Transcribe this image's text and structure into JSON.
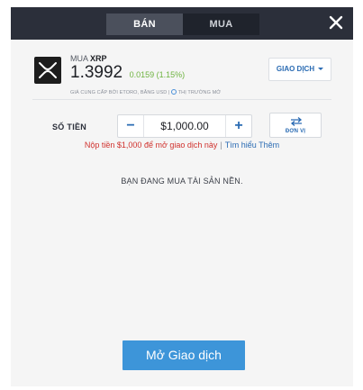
{
  "tabs": [
    {
      "label": "BÁN",
      "active": true
    },
    {
      "label": "MUA",
      "active": false
    }
  ],
  "close_icon": "close-icon",
  "instrument": {
    "action_prefix": "MUA",
    "symbol": "XRP",
    "price": "1.3992",
    "change": "0.0159 (1.15%)",
    "provider": "GIÁ CUNG CẤP BỞI ETORO, BẰNG USD",
    "separator": "|",
    "market_status": "THỊ TRƯỜNG MỞ"
  },
  "trade_dropdown": {
    "label": "GIAO DỊCH"
  },
  "amount": {
    "label": "SỐ TIỀN",
    "value": "$1,000.00",
    "minus": "−",
    "plus": "+"
  },
  "unit_button": {
    "label": "ĐƠN VỊ"
  },
  "notice": {
    "error": "Nộp tiền $1,000 để mở giao dịch này",
    "separator": "|",
    "link": "Tìm hiểu Thêm"
  },
  "underlying_text": "BẠN ĐANG MUA TÀI SẢN NỀN.",
  "open_button": {
    "label": "Mở Giao dịch"
  },
  "colors": {
    "topbar": "#2b2f3a",
    "accent_blue": "#2a6bb3",
    "button_blue": "#3d95d9",
    "positive_green": "#6db33f",
    "error_red": "#d0312d"
  }
}
